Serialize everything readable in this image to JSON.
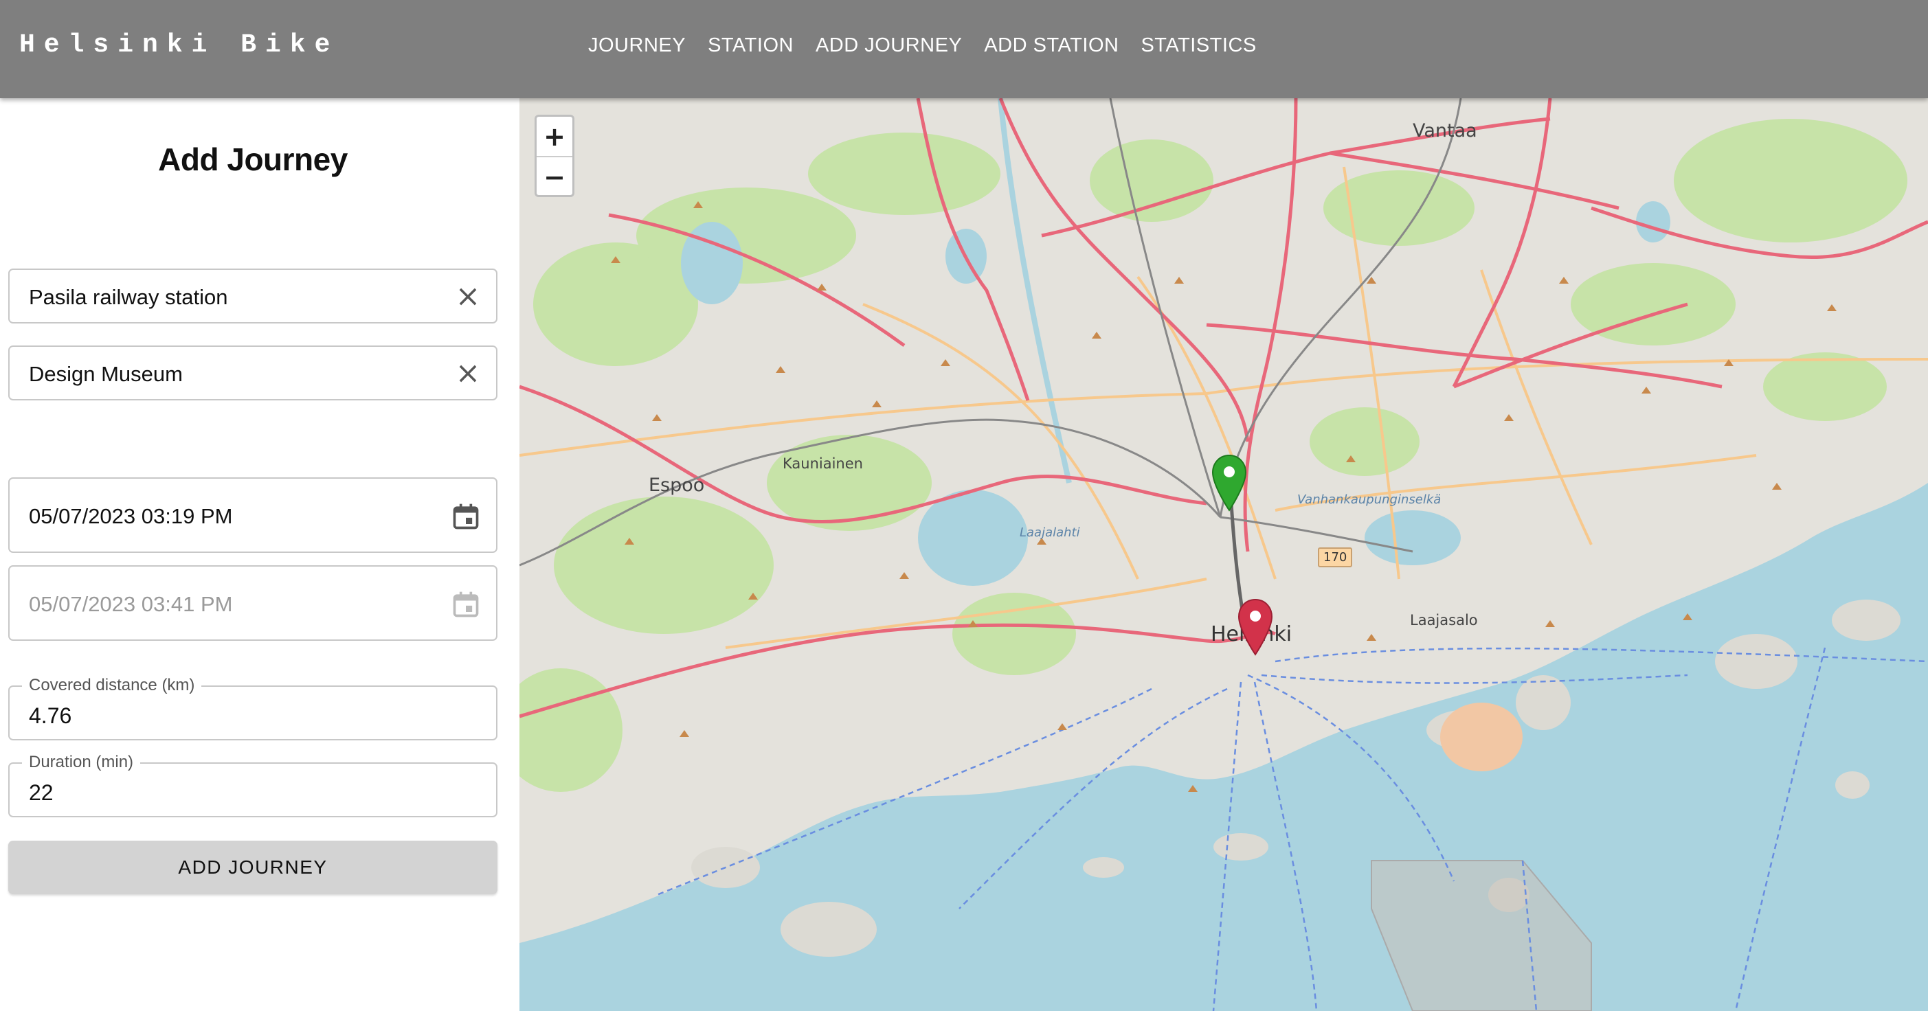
{
  "app": {
    "brand": "Helsinki Bike"
  },
  "nav": [
    {
      "label": "JOURNEY"
    },
    {
      "label": "STATION"
    },
    {
      "label": "ADD JOURNEY"
    },
    {
      "label": "ADD STATION"
    },
    {
      "label": "STATISTICS"
    }
  ],
  "form": {
    "title": "Add Journey",
    "departure_station": "Pasila railway station",
    "return_station": "Design Museum",
    "departure_time": "05/07/2023 03:19 PM",
    "return_time": "05/07/2023 03:41 PM",
    "distance_label": "Covered distance (km)",
    "distance_value": "4.76",
    "duration_label": "Duration (min)",
    "duration_value": "22",
    "submit_label": "ADD JOURNEY"
  },
  "map": {
    "zoom_in": "+",
    "zoom_out": "−",
    "labels": {
      "vantaa": "Vantaa",
      "espoo": "Espoo",
      "kauniainen": "Kauniainen",
      "helsinki": "Helsinki",
      "laajasalo": "Laajasalo",
      "laajalahti": "Laajalahti",
      "vanhankaupunginselka": "Vanhankaupunginselkä",
      "road_170": "170"
    },
    "markers": {
      "start_color": "#2fa82f",
      "end_color": "#d2324a"
    }
  }
}
